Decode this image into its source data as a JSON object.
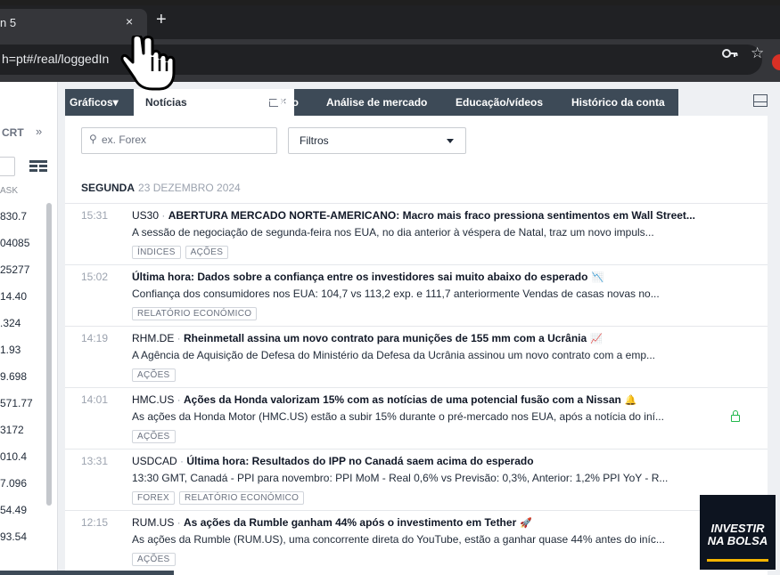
{
  "browser": {
    "tab_title": "n 5",
    "tab_close": "×",
    "new_tab": "+",
    "url": "h=pt#/real/loggedIn",
    "star": "☆"
  },
  "left_panel": {
    "header": "CRT",
    "arrows": "»",
    "ask_label": "ASK",
    "values": [
      "830.7",
      "04085",
      "25277",
      "14.40",
      ".324",
      "1.93",
      "9.698",
      "571.77",
      "3172",
      "010.4",
      "7.096",
      "54.49",
      "93.54"
    ]
  },
  "tabs": {
    "graficos": "Gráficos▾",
    "noticias": "Notícias",
    "close": "×",
    "calendario": "Calendário",
    "analise": "Análise de mercado",
    "educacao": "Educação/vídeos",
    "historico": "Histórico da conta"
  },
  "search": {
    "placeholder": "ex. Forex",
    "icon": "⚲"
  },
  "filter": {
    "label": "Filtros"
  },
  "day_header": {
    "weekday": "SEGUNDA",
    "date": "23 DEZEMBRO 2024"
  },
  "news": [
    {
      "time": "15:31",
      "symbol": "US30",
      "headline": "ABERTURA MERCADO NORTE-AMERICANO: Macro mais fraco pressiona sentimentos em Wall Street...",
      "emoji": "",
      "body": "A sessão de negociação de segunda-feira nos EUA, no dia anterior à véspera de Natal, traz um novo impuls...",
      "tags": [
        "ÍNDICES",
        "AÇÕES"
      ]
    },
    {
      "time": "15:02",
      "symbol": "",
      "headline": "Última hora: Dados sobre a confiança entre os investidores sai muito abaixo do esperado",
      "emoji": "📉",
      "body": "Confiança dos consumidores nos EUA: 104,7 vs 113,2 exp. e 111,7 anteriormente Vendas de casas novas no...",
      "tags": [
        "RELATÓRIO ECONÓMICO"
      ]
    },
    {
      "time": "14:19",
      "symbol": "RHM.DE",
      "headline": "Rheinmetall assina um novo contrato para munições de 155 mm com a Ucrânia",
      "emoji": "📈",
      "body": "A Agência de Aquisição de Defesa do Ministério da Defesa da Ucrânia assinou um novo contrato com a emp...",
      "tags": [
        "AÇÕES"
      ]
    },
    {
      "time": "14:01",
      "symbol": "HMC.US",
      "headline": "Ações da Honda valorizam 15% com as notícias de uma potencial fusão com a Nissan",
      "emoji": "🔔",
      "body": "As ações da Honda Motor (HMC.US) estão a subir 15% durante o pré-mercado nos EUA, após a notícia do iní...",
      "tags": [
        "AÇÕES"
      ]
    },
    {
      "time": "13:31",
      "symbol": "USDCAD",
      "headline": "Última hora: Resultados do IPP no Canadá saem acima do esperado",
      "emoji": "",
      "body": "13:30 GMT, Canadá - PPI para novembro: PPI MoM - Real 0,6% vs Previsão: 0,3%, Anterior: 1,2% PPI YoY - R...",
      "tags": [
        "FOREX",
        "RELATÓRIO ECONÓMICO"
      ]
    },
    {
      "time": "12:15",
      "symbol": "RUM.US",
      "headline": "As ações da Rumble ganham 44% após o investimento em Tether",
      "emoji": "🚀",
      "body": "As ações da Rumble (RUM.US), uma concorrente direta do YouTube, estão a ganhar quase 44% antes do iníc...",
      "tags": [
        "AÇÕES"
      ]
    }
  ],
  "logo": {
    "line1": "INVESTIR",
    "line2": "NA BOLSA"
  }
}
